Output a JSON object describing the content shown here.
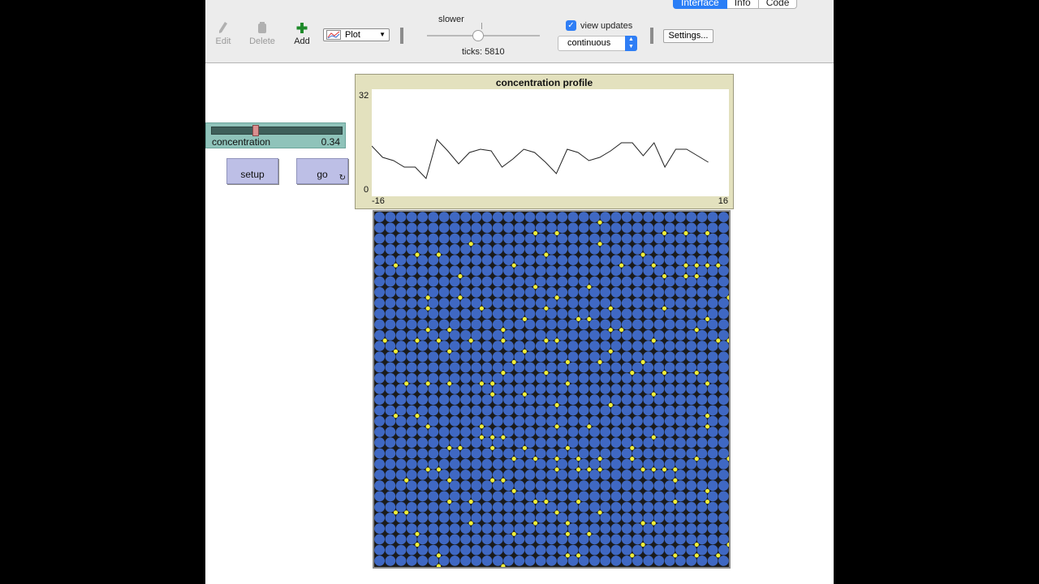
{
  "toolbar": {
    "edit_label": "Edit",
    "delete_label": "Delete",
    "add_label": "Add",
    "widget_type": "Plot",
    "speed_label": "slower",
    "ticks_text": "ticks: 5810",
    "view_updates_label": "view updates",
    "view_updates_checked": true,
    "update_mode": "continuous",
    "settings_label": "Settings..."
  },
  "tabs": [
    {
      "label": "Interface",
      "active": true
    },
    {
      "label": "Info",
      "active": false
    },
    {
      "label": "Code",
      "active": false
    }
  ],
  "slider": {
    "name": "concentration",
    "value": "0.34",
    "fraction": 0.34
  },
  "buttons": {
    "setup_label": "setup",
    "go_label": "go",
    "go_forever_icon": "forever-arrows-icon"
  },
  "plot": {
    "title": "concentration profile",
    "y_max_label": "32",
    "y_min_label": "0",
    "x_min_label": "-16",
    "x_max_label": "16"
  },
  "chart_data": {
    "type": "line",
    "title": "concentration profile",
    "xlim": [
      -16,
      16
    ],
    "ylim": [
      0,
      32
    ],
    "x": [
      -16,
      -15,
      -14,
      -13,
      -12,
      -11,
      -10,
      -9,
      -8,
      -7,
      -6,
      -5,
      -4,
      -3,
      -2,
      -1,
      0,
      1,
      2,
      3,
      4,
      5,
      6,
      7,
      8,
      9,
      10,
      11,
      12,
      13,
      14,
      15
    ],
    "values": [
      15,
      11.5,
      10.5,
      8.5,
      8.5,
      5,
      17,
      13.5,
      9.5,
      13,
      14,
      13.5,
      8.5,
      11,
      14,
      13,
      10,
      6.5,
      14,
      13,
      10.5,
      11.5,
      13.5,
      16,
      16,
      12,
      16,
      8.5,
      14,
      14,
      12,
      10
    ]
  },
  "world": {
    "background_color": "#1b1b1b",
    "patch_color": "#3f68c3",
    "particle_color": "#eeee3a"
  },
  "colors": {
    "accent": "#2a7ef6",
    "slider_bg": "#8fc3ba",
    "button_bg": "#bdbfe6",
    "plot_bg": "#e3e1be"
  }
}
